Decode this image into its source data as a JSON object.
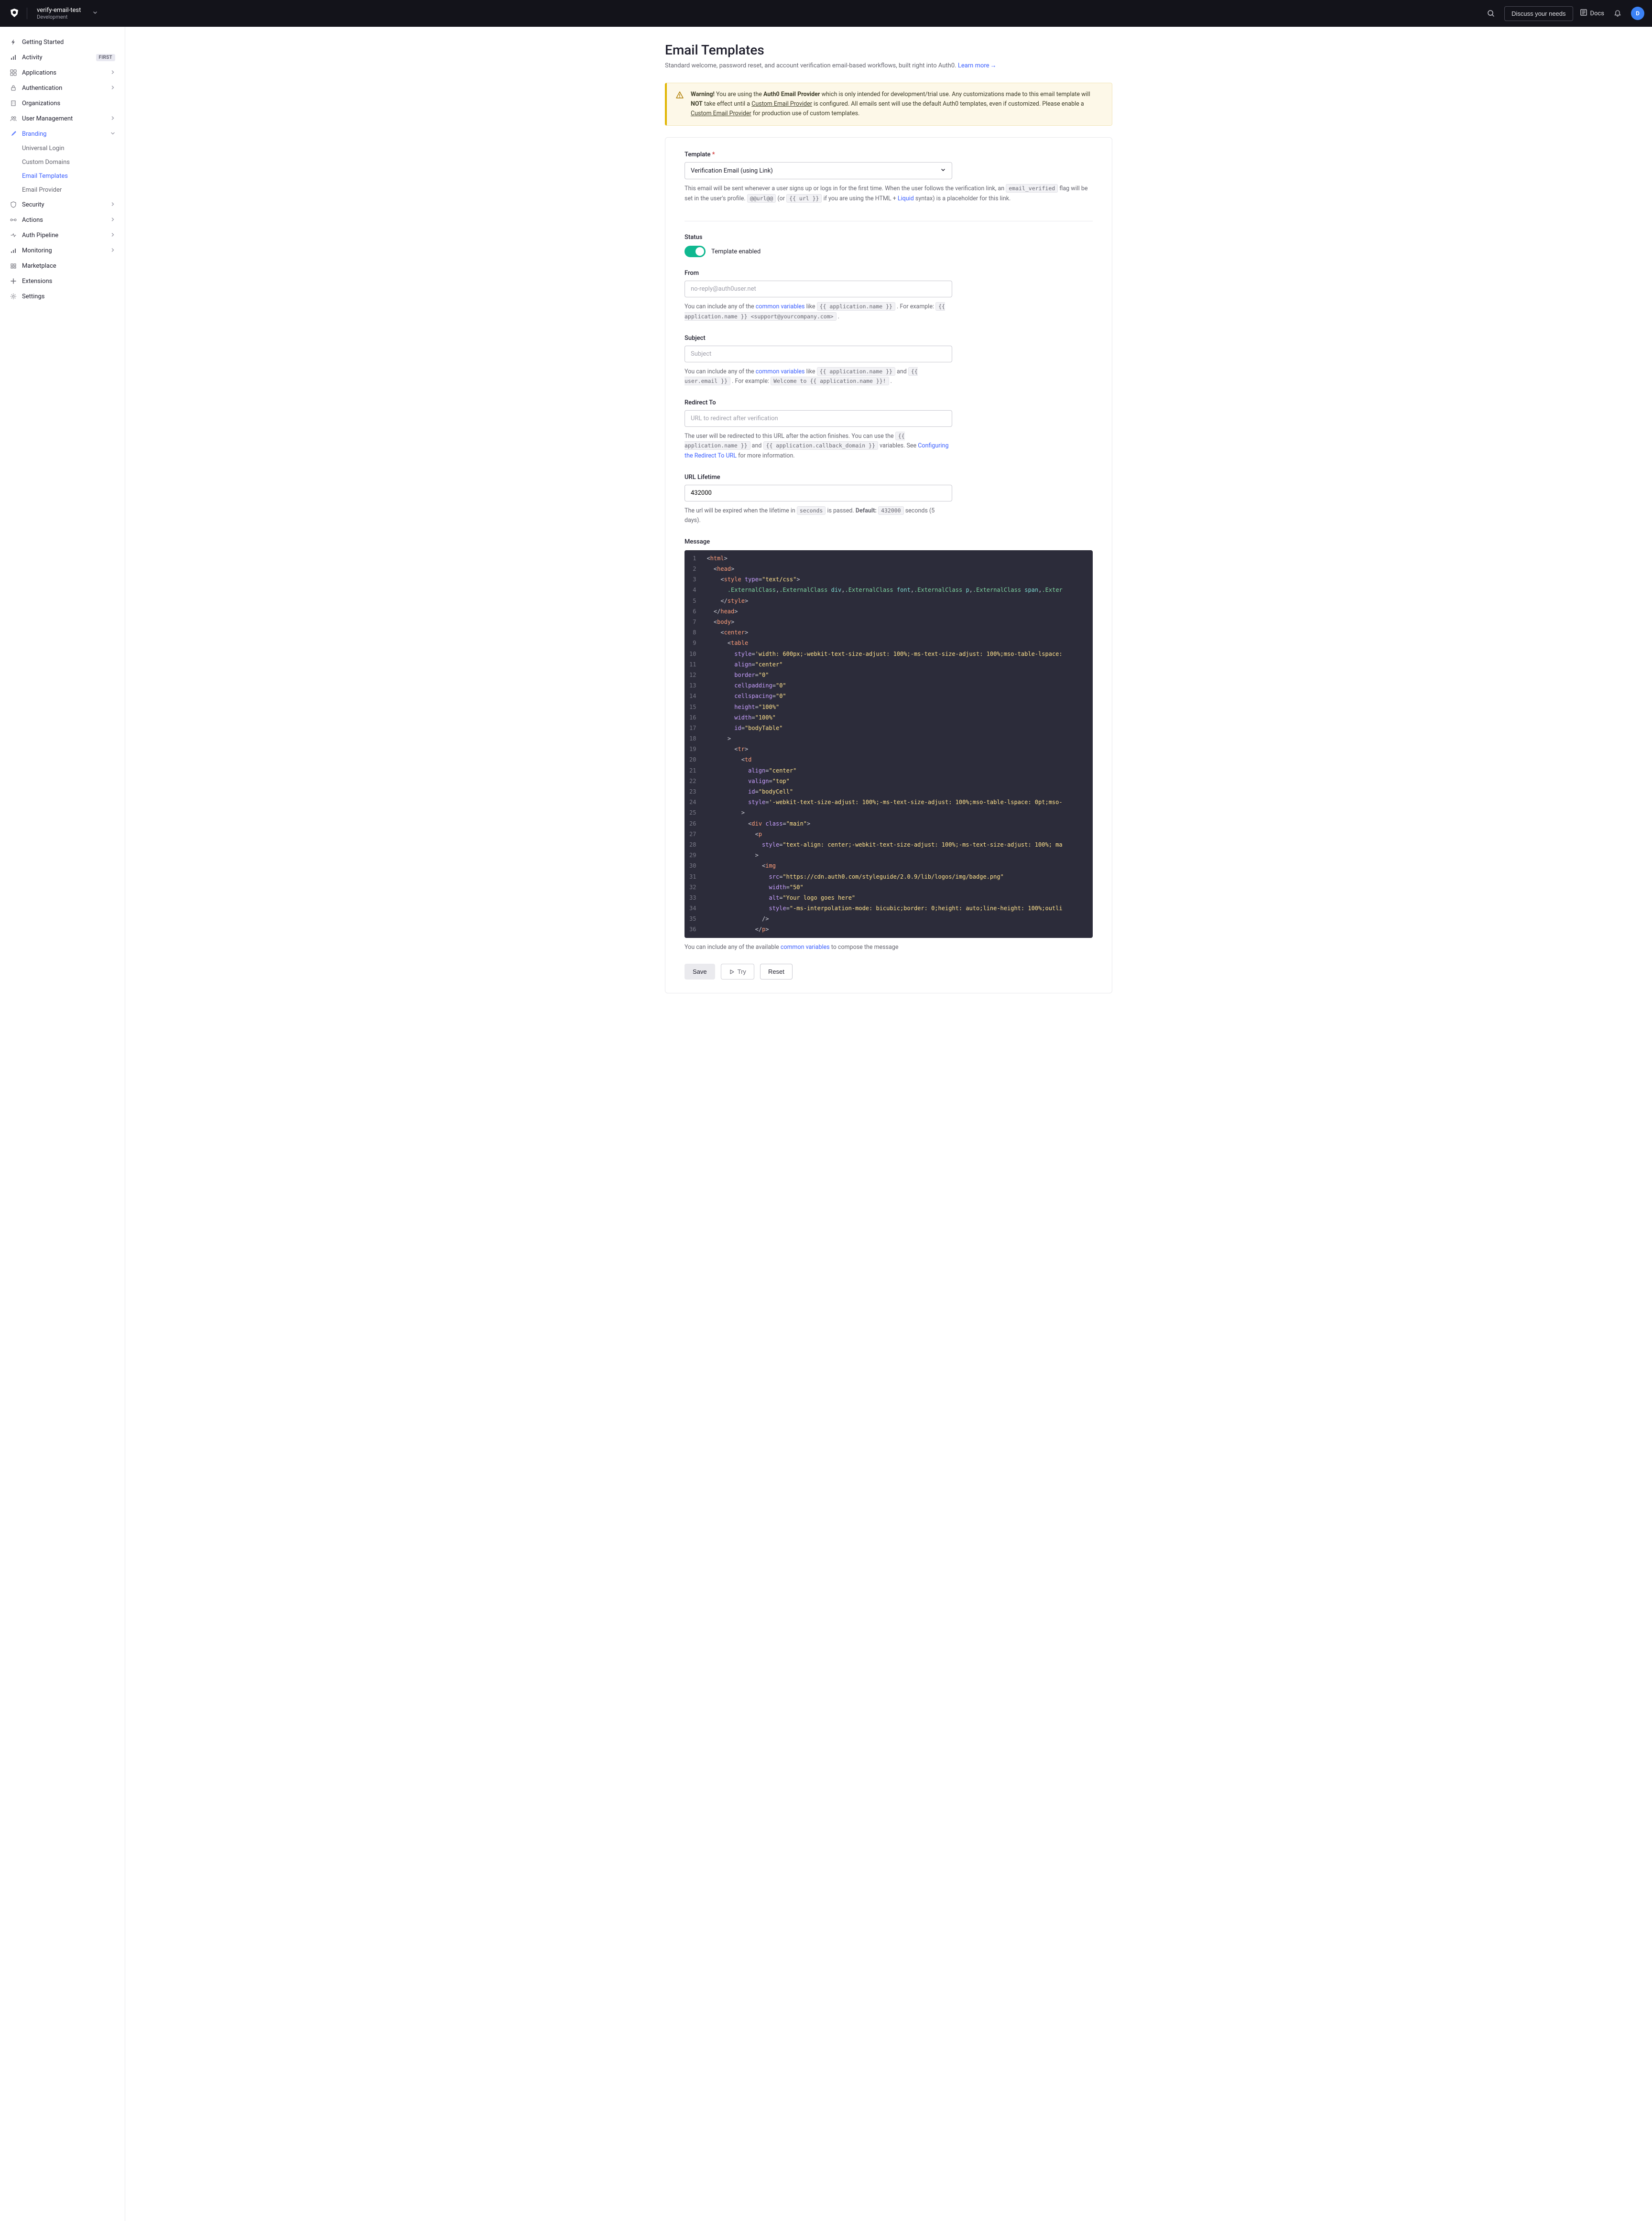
{
  "header": {
    "project_name": "verify-email-test",
    "env": "Development",
    "discuss": "Discuss your needs",
    "docs": "Docs",
    "avatar_letter": "D"
  },
  "sidebar": {
    "items": [
      {
        "label": "Getting Started",
        "icon": "bolt"
      },
      {
        "label": "Activity",
        "icon": "chart",
        "badge": "FIRST"
      },
      {
        "label": "Applications",
        "icon": "apps",
        "chevron": true
      },
      {
        "label": "Authentication",
        "icon": "lock",
        "chevron": true
      },
      {
        "label": "Organizations",
        "icon": "org"
      },
      {
        "label": "User Management",
        "icon": "users",
        "chevron": true
      },
      {
        "label": "Branding",
        "icon": "brush",
        "chevron": true,
        "active": true
      },
      {
        "label": "Security",
        "icon": "shield",
        "chevron": true
      },
      {
        "label": "Actions",
        "icon": "flow",
        "chevron": true
      },
      {
        "label": "Auth Pipeline",
        "icon": "pipeline",
        "chevron": true
      },
      {
        "label": "Monitoring",
        "icon": "monitor",
        "chevron": true
      },
      {
        "label": "Marketplace",
        "icon": "market"
      },
      {
        "label": "Extensions",
        "icon": "ext"
      },
      {
        "label": "Settings",
        "icon": "gear"
      }
    ],
    "branding_sub": [
      {
        "label": "Universal Login"
      },
      {
        "label": "Custom Domains"
      },
      {
        "label": "Email Templates",
        "active": true
      },
      {
        "label": "Email Provider"
      }
    ]
  },
  "page": {
    "title": "Email Templates",
    "subtitle": "Standard welcome, password reset, and account verification email-based workflows, built right into Auth0.",
    "learn_more": "Learn more"
  },
  "warning": {
    "pre": "Warning!",
    "t1": " You are using the ",
    "bold1": "Auth0 Email Provider",
    "t2": " which is only intended for development/trial use. Any customizations made to this email template will ",
    "bold2": "NOT",
    "t3": " take effect until a ",
    "link1": "Custom Email Provider",
    "t4": " is configured. All emails sent will use the default Auth0 templates, even if customized. Please enable a ",
    "link2": "Custom Email Provider",
    "t5": " for production use of custom templates."
  },
  "form": {
    "template_label": "Template",
    "template_value": "Verification Email (using Link)",
    "template_help_1": "This email will be sent whenever a user signs up or logs in for the first time. When the user follows the verification link, an ",
    "template_help_code1": "email_verified",
    "template_help_2": " flag will be set in the user's profile. ",
    "template_help_code2": "@@url@@",
    "template_help_3": " (or ",
    "template_help_code3": "{{ url }}",
    "template_help_4": " if you are using the HTML + ",
    "template_help_liquid": "Liquid",
    "template_help_5": " syntax) is a placeholder for this link.",
    "status_label": "Status",
    "status_enabled": "Template enabled",
    "from_label": "From",
    "from_placeholder": "no-reply@auth0user.net",
    "from_help_1": "You can include any of the ",
    "common_variables": "common variables",
    "from_help_2": " like ",
    "from_help_code1": "{{ application.name }}",
    "from_help_3": " . For example: ",
    "from_help_code2": "{{ application.name }} <support@yourcompany.com>",
    "from_help_4": " .",
    "subject_label": "Subject",
    "subject_placeholder": "Subject",
    "subject_help_1": "You can include any of the ",
    "subject_help_2": " like ",
    "subject_help_code1": "{{ application.name }}",
    "subject_help_3": " and ",
    "subject_help_code2": "{{ user.email }}",
    "subject_help_4": " . For example: ",
    "subject_help_code3": "Welcome to {{ application.name }}!",
    "subject_help_5": " .",
    "redirect_label": "Redirect To",
    "redirect_placeholder": "URL to redirect after verification",
    "redirect_help_1": "The user will be redirected to this URL after the action finishes. You can use the ",
    "redirect_help_code1": "{{ application.name }}",
    "redirect_help_2": " and ",
    "redirect_help_code2": "{{ application.callback_domain }}",
    "redirect_help_3": " variables. See ",
    "redirect_help_link": "Configuring the Redirect To URL",
    "redirect_help_4": " for more information.",
    "lifetime_label": "URL Lifetime",
    "lifetime_value": "432000",
    "lifetime_help_1": "The url will be expired when the lifetime in ",
    "lifetime_help_code1": "seconds",
    "lifetime_help_2": " is passed. ",
    "lifetime_help_bold": "Default:",
    "lifetime_help_code2": "432000",
    "lifetime_help_3": " seconds (5 days).",
    "message_label": "Message",
    "message_help_1": "You can include any of the available ",
    "message_help_2": " to compose the message",
    "save_btn": "Save",
    "try_btn": "Try",
    "reset_btn": "Reset"
  }
}
